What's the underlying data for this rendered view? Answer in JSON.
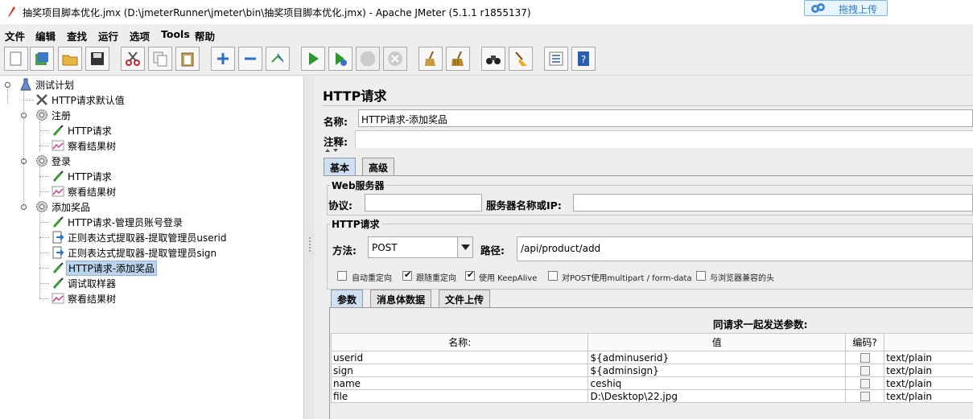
{
  "window": {
    "title": "抽奖项目脚本优化.jmx (D:\\jmeterRunner\\jmeter\\bin\\抽奖项目脚本优化.jmx) - Apache JMeter (5.1.1 r1855137)",
    "upload_button": "拖拽上传"
  },
  "menu": [
    "文件",
    "编辑",
    "查找",
    "运行",
    "选项",
    "Tools",
    "帮助"
  ],
  "toolbar": {
    "buttons": [
      "new-icon",
      "templates-icon",
      "open-icon",
      "save-icon",
      "cut-icon",
      "copy-icon",
      "paste-icon",
      "expand-icon",
      "collapse-icon",
      "toggle-icon",
      "start-icon",
      "start-no-pause-icon",
      "stop-icon",
      "shutdown-icon",
      "clear-icon",
      "clear-all-icon",
      "search-icon",
      "reset-search-icon",
      "function-helper-icon",
      "help-icon"
    ]
  },
  "tree": {
    "root": "测试计划",
    "items": [
      {
        "label": "HTTP请求默认值",
        "icon": "config-wrench-icon"
      },
      {
        "label": "注册",
        "icon": "thread-group-gear-icon"
      },
      {
        "label": "HTTP请求",
        "icon": "sampler-pipette-icon"
      },
      {
        "label": "察看结果树",
        "icon": "listener-chart-icon"
      },
      {
        "label": "登录",
        "icon": "thread-group-gear-icon"
      },
      {
        "label": "HTTP请求",
        "icon": "sampler-pipette-icon"
      },
      {
        "label": "察看结果树",
        "icon": "listener-chart-icon"
      },
      {
        "label": "添加奖品",
        "icon": "thread-group-gear-icon"
      },
      {
        "label": "HTTP请求-管理员账号登录",
        "icon": "sampler-pipette-icon"
      },
      {
        "label": "正则表达式提取器-提取管理员userid",
        "icon": "extractor-arrow-icon"
      },
      {
        "label": "正则表达式提取器-提取管理员sign",
        "icon": "extractor-arrow-icon"
      },
      {
        "label": "HTTP请求-添加奖品",
        "icon": "sampler-pipette-icon"
      },
      {
        "label": "调试取样器",
        "icon": "sampler-pipette-icon"
      },
      {
        "label": "察看结果树",
        "icon": "listener-chart-icon"
      }
    ]
  },
  "panel": {
    "title": "HTTP请求",
    "name_label": "名称:",
    "name_value": "HTTP请求-添加奖品",
    "comment_label": "注释:",
    "comment_value": "",
    "tabs": [
      "基本",
      "高级"
    ],
    "web_server_group": "Web服务器",
    "protocol_label": "协议:",
    "protocol_value": "",
    "server_label": "服务器名称或IP:",
    "server_value": "",
    "http_group": "HTTP请求",
    "method_label": "方法:",
    "method_value": "POST",
    "path_label": "路径:",
    "path_value": "/api/product/add",
    "options": [
      {
        "label": "自动重定向",
        "checked": false
      },
      {
        "label": "跟随重定向",
        "checked": true
      },
      {
        "label": "使用 KeepAlive",
        "checked": true
      },
      {
        "label": "对POST使用multipart / form-data",
        "checked": false
      },
      {
        "label": "与浏览器兼容的头",
        "checked": false
      }
    ],
    "sub_tabs": [
      "参数",
      "消息体数据",
      "文件上传"
    ],
    "params_caption": "同请求一起发送参数:",
    "columns": [
      "名称:",
      "值",
      "编码?",
      ""
    ],
    "rows": [
      {
        "name": "userid",
        "value": "${adminuserid}",
        "encode": false,
        "content_type": "text/plain"
      },
      {
        "name": "sign",
        "value": "${adminsign}",
        "encode": false,
        "content_type": "text/plain"
      },
      {
        "name": "name",
        "value": "ceshiq",
        "encode": false,
        "content_type": "text/plain"
      },
      {
        "name": "file",
        "value": "D:\\Desktop\\22.jpg",
        "encode": false,
        "content_type": "text/plain"
      }
    ]
  }
}
